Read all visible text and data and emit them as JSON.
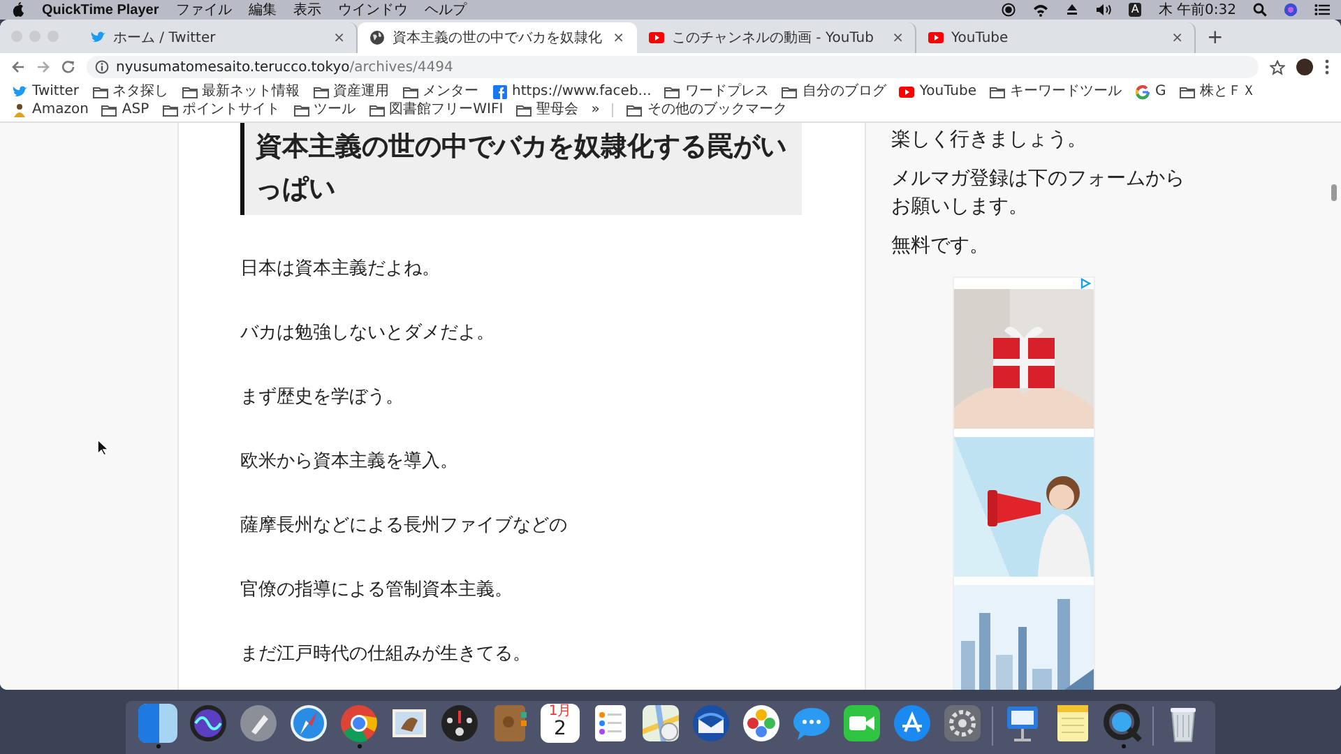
{
  "menu_bar": {
    "app": "QuickTime Player",
    "menus": [
      "ファイル",
      "編集",
      "表示",
      "ウインドウ",
      "ヘルプ"
    ],
    "input_mode": "A",
    "clock": "木 午前0:32"
  },
  "browser": {
    "tabs": [
      {
        "kind": "twitter",
        "title": "ホーム / Twitter",
        "close": "×",
        "selected": false
      },
      {
        "kind": "globe",
        "title": "資本主義の世の中でバカを奴隷化",
        "close": "×",
        "selected": true
      },
      {
        "kind": "youtube",
        "title": "このチャンネルの動画 - YouTub",
        "close": "×",
        "selected": false
      },
      {
        "kind": "youtube",
        "title": "YouTube",
        "close": "×",
        "selected": false
      }
    ],
    "new_tab": "+",
    "address": {
      "host": "nyusumatomesaito.terucco.tokyo",
      "path": "/archives/4494"
    },
    "bookmarks": [
      {
        "kind": "twitter",
        "label": "Twitter"
      },
      {
        "kind": "folder",
        "label": "ネタ探し"
      },
      {
        "kind": "folder",
        "label": "最新ネット情報"
      },
      {
        "kind": "folder",
        "label": "資産運用"
      },
      {
        "kind": "folder",
        "label": "メンター"
      },
      {
        "kind": "facebook",
        "label": "https://www.faceb..."
      },
      {
        "kind": "folder",
        "label": "ワードプレス"
      },
      {
        "kind": "folder",
        "label": "自分のブログ"
      },
      {
        "kind": "youtube",
        "label": "YouTube"
      },
      {
        "kind": "folder",
        "label": "キーワードツール"
      },
      {
        "kind": "google",
        "label": "G"
      },
      {
        "kind": "folder",
        "label": "株とＦＸ"
      },
      {
        "kind": "amazon",
        "label": "Amazon"
      },
      {
        "kind": "folder",
        "label": "ASP"
      },
      {
        "kind": "folder",
        "label": "ポイントサイト"
      },
      {
        "kind": "folder",
        "label": "ツール"
      },
      {
        "kind": "folder",
        "label": "図書館フリーWIFI"
      },
      {
        "kind": "folder",
        "label": "聖母会"
      }
    ],
    "overflow": "»",
    "other_bookmarks": "その他のブックマーク"
  },
  "article": {
    "heading": "資本主義の世の中でバカを奴隷化する罠がいっぱい",
    "paragraphs": [
      "日本は資本主義だよね。",
      "バカは勉強しないとダメだよ。",
      "まず歴史を学ぼう。",
      "欧米から資本主義を導入。",
      "薩摩長州などによる長州ファイブなどの",
      "官僚の指導による管制資本主義。",
      "まだ江戸時代の仕組みが生きてる。"
    ]
  },
  "sidebar": {
    "paragraphs": [
      {
        "lines": [
          "楽しく行きましょう。"
        ]
      },
      {
        "lines": [
          "メルマガ登録は下のフォームから",
          "お願いします。"
        ]
      },
      {
        "lines": [
          "無料です。"
        ]
      }
    ]
  },
  "dock": {
    "apps": [
      {
        "kind": "app",
        "running": true
      },
      {
        "kind": "app",
        "running": false
      },
      {
        "kind": "app",
        "running": false
      },
      {
        "kind": "app",
        "running": false
      },
      {
        "kind": "app",
        "running": true
      },
      {
        "kind": "app",
        "running": false
      },
      {
        "kind": "app",
        "running": false
      },
      {
        "kind": "app",
        "running": false
      },
      {
        "kind": "calendar",
        "running": false,
        "month": "1月",
        "day": "2"
      },
      {
        "kind": "app",
        "running": false
      },
      {
        "kind": "app",
        "running": false
      },
      {
        "kind": "app",
        "running": false
      },
      {
        "kind": "app",
        "running": false
      },
      {
        "kind": "app",
        "running": false
      },
      {
        "kind": "app",
        "running": false
      },
      {
        "kind": "app",
        "running": false
      },
      {
        "kind": "app",
        "running": false
      }
    ],
    "documents": [
      {
        "kind": "app",
        "running": false
      },
      {
        "kind": "app",
        "running": false
      },
      {
        "kind": "app",
        "running": true
      }
    ]
  }
}
